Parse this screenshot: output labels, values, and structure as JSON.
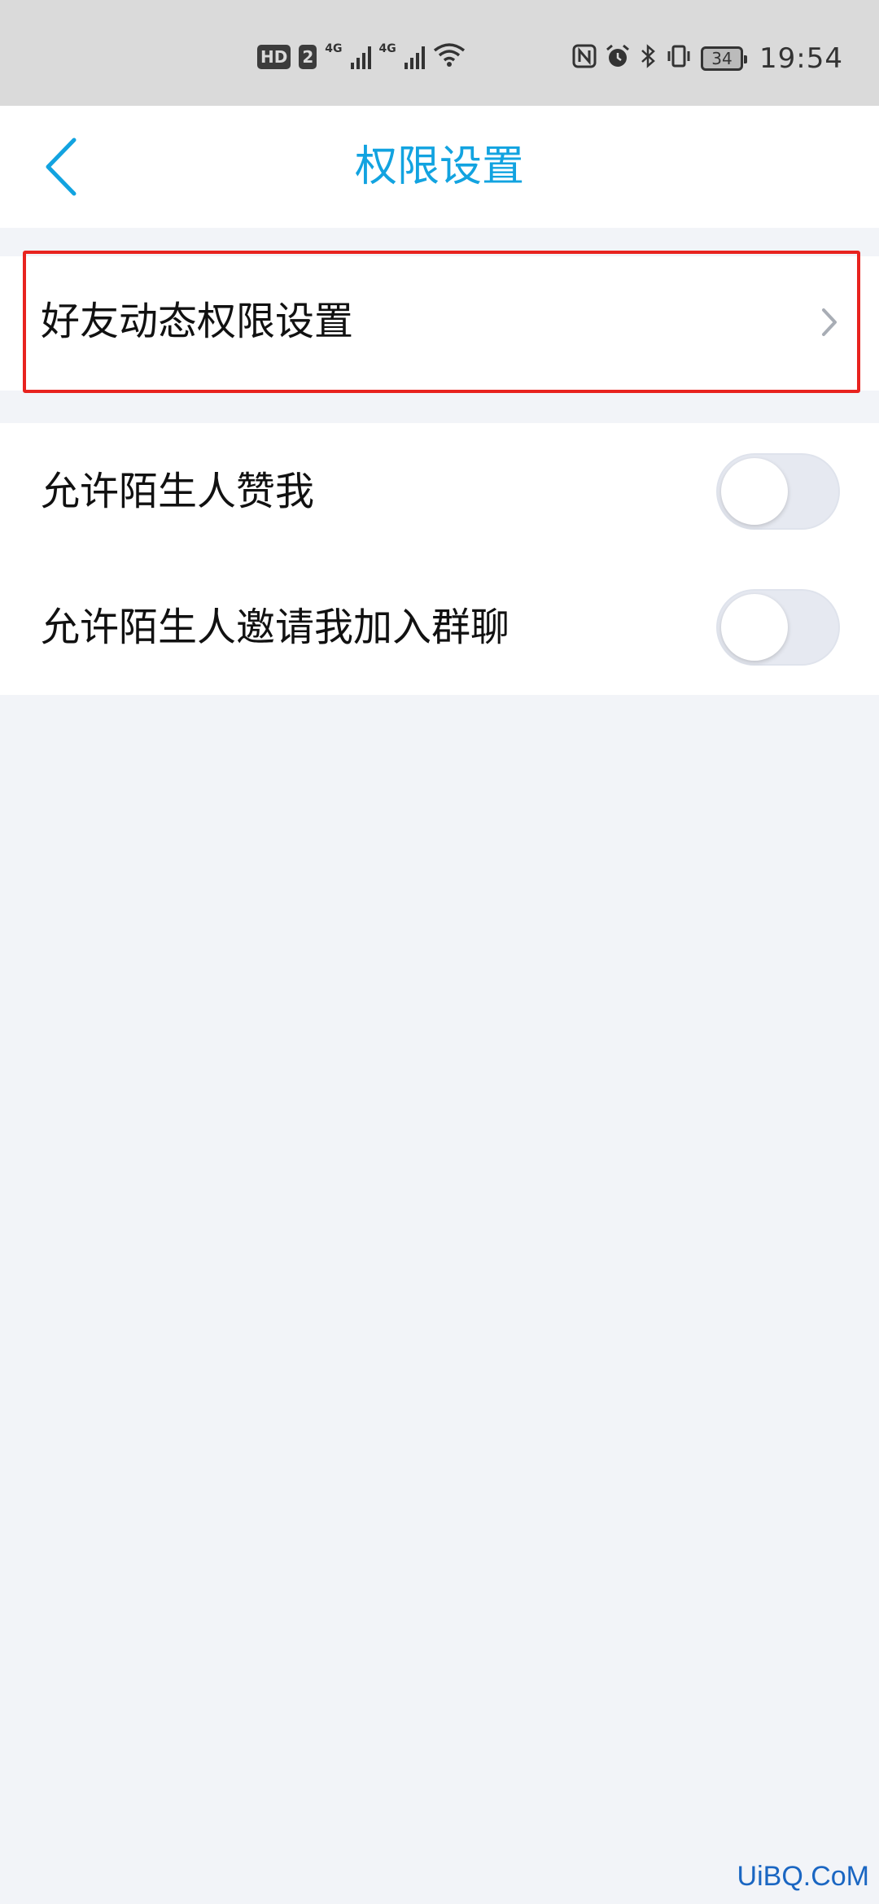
{
  "status_bar": {
    "hd_badge": "HD",
    "sim_badge": "2",
    "net1": "4G",
    "net2": "4G",
    "battery_level": "34",
    "time": "19:54",
    "icons": [
      "hd-icon",
      "signal-icon",
      "signal-icon",
      "wifi-icon",
      "nfc-icon",
      "alarm-icon",
      "bluetooth-icon",
      "vibrate-icon",
      "battery-icon"
    ]
  },
  "header": {
    "title": "权限设置",
    "back_icon": "chevron-left-icon",
    "accent_color": "#12a3e0"
  },
  "sections": {
    "friend_feed": {
      "label": "好友动态权限设置",
      "chevron_icon": "chevron-right-icon",
      "highlight_color": "#e8231f"
    },
    "toggles": [
      {
        "label": "允许陌生人赞我",
        "enabled": false
      },
      {
        "label": "允许陌生人邀请我加入群聊",
        "enabled": false
      }
    ]
  },
  "watermark": "UiBQ.CoM"
}
